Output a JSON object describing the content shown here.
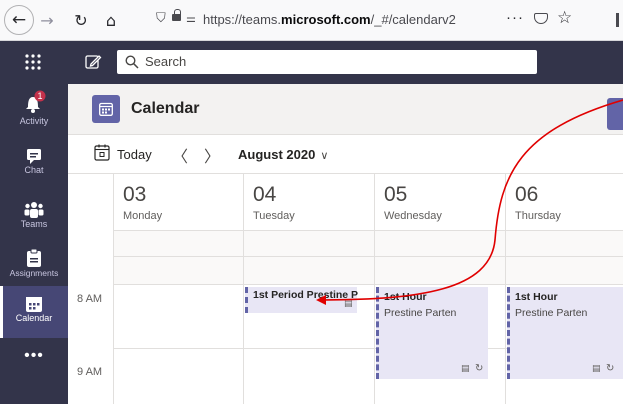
{
  "browser": {
    "back_icon": "arrow-left-icon",
    "forward_icon": "arrow-right-icon",
    "reload_icon": "reload-icon",
    "home_icon": "home-icon",
    "url_prefix": "https://teams.",
    "url_domain": "microsoft.com",
    "url_path": "/_#/calendarv2",
    "more_icon": "ellipsis-icon",
    "pocket_icon": "pocket-icon",
    "bookmark_icon": "star-icon"
  },
  "teams_bar": {
    "search_placeholder": "Search"
  },
  "sidebar": {
    "items": [
      {
        "label": "Activity",
        "icon": "bell-icon",
        "badge": "1"
      },
      {
        "label": "Chat",
        "icon": "chat-icon"
      },
      {
        "label": "Teams",
        "icon": "teams-icon"
      },
      {
        "label": "Assignments",
        "icon": "assignments-icon"
      },
      {
        "label": "Calendar",
        "icon": "calendar-icon"
      },
      {
        "label": "",
        "icon": "more-apps-icon"
      }
    ]
  },
  "header": {
    "title": "Calendar"
  },
  "toolbar": {
    "today_label": "Today",
    "month_label": "August 2020"
  },
  "days": [
    {
      "num": "03",
      "name": "Monday"
    },
    {
      "num": "04",
      "name": "Tuesday"
    },
    {
      "num": "05",
      "name": "Wednesday"
    },
    {
      "num": "06",
      "name": "Thursday"
    }
  ],
  "times": [
    "8 AM",
    "9 AM"
  ],
  "events": [
    {
      "title": "1st Period  Prestine P",
      "subtitle": ""
    },
    {
      "title": "1st Hour",
      "subtitle": "Prestine Parten"
    },
    {
      "title": "1st Hour",
      "subtitle": "Prestine Parten"
    }
  ],
  "colors": {
    "teams_dark": "#33344a",
    "accent": "#6264a7",
    "event_bg": "#e8e6f5",
    "annotation_arrow": "#e00000",
    "badge": "#c4314b"
  }
}
